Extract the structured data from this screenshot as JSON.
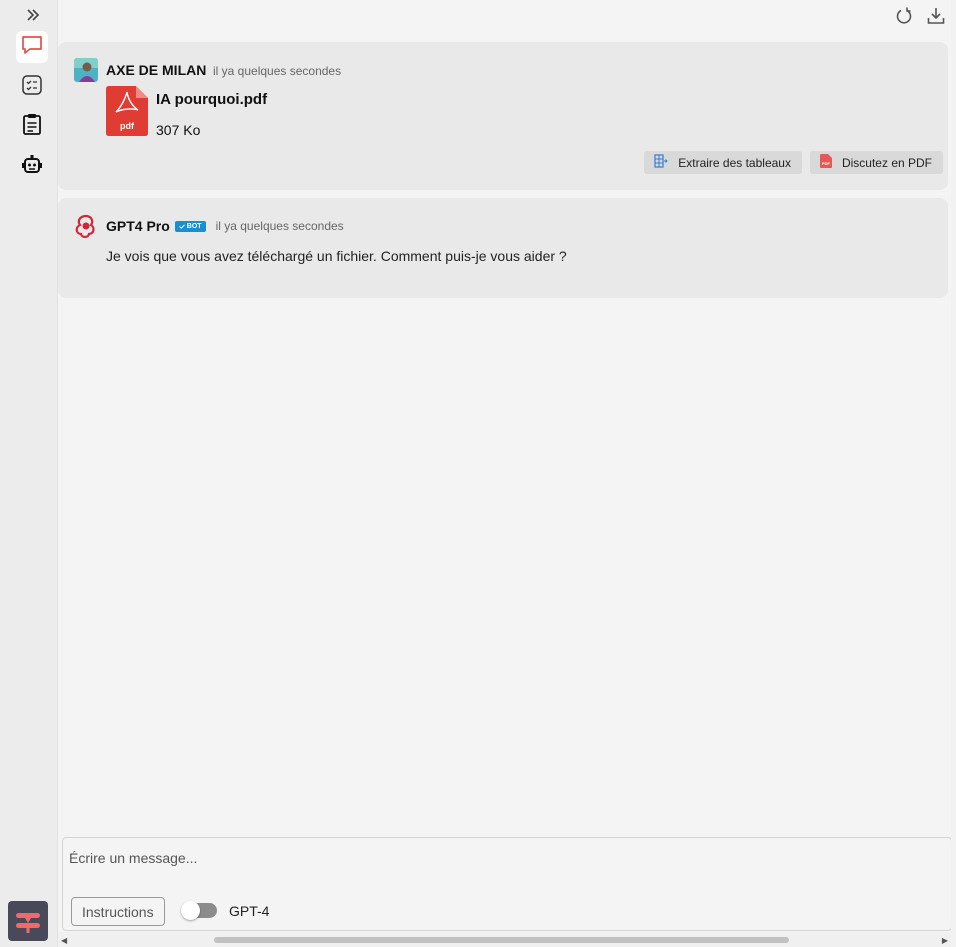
{
  "sidebar": {
    "expand_icon": "double-chevron-right-icon",
    "items": [
      {
        "icon": "chat-bubble-icon",
        "active": true
      },
      {
        "icon": "checklist-icon",
        "active": false
      },
      {
        "icon": "clipboard-icon",
        "active": false
      },
      {
        "icon": "robot-icon",
        "active": false
      }
    ],
    "logo_icon": "app-logo-icon"
  },
  "toolbar": {
    "reset_icon": "refresh-icon",
    "download_icon": "download-icon"
  },
  "messages": [
    {
      "author": "AXE DE MILAN",
      "time": "il ya quelques secondes",
      "file": {
        "name": "IA pourquoi.pdf",
        "size": "307 Ko",
        "icon_label": "pdf"
      },
      "actions": [
        {
          "label": "Extraire des tableaux",
          "icon": "table-extract-icon"
        },
        {
          "label": "Discutez en PDF",
          "icon": "pdf-small-icon"
        }
      ]
    },
    {
      "author": "GPT4 Pro",
      "badge": "BOT",
      "time": "il ya quelques secondes",
      "text": "Je vois que vous avez téléchargé un fichier. Comment puis-je vous aider ?"
    }
  ],
  "composer": {
    "placeholder": "Écrire un message...",
    "instructions_label": "Instructions",
    "model_label": "GPT-4",
    "toggle_on": false
  },
  "colors": {
    "accent": "#e4504a",
    "bot_badge": "#1a8fd0",
    "message_bg": "#e9e9e9"
  }
}
